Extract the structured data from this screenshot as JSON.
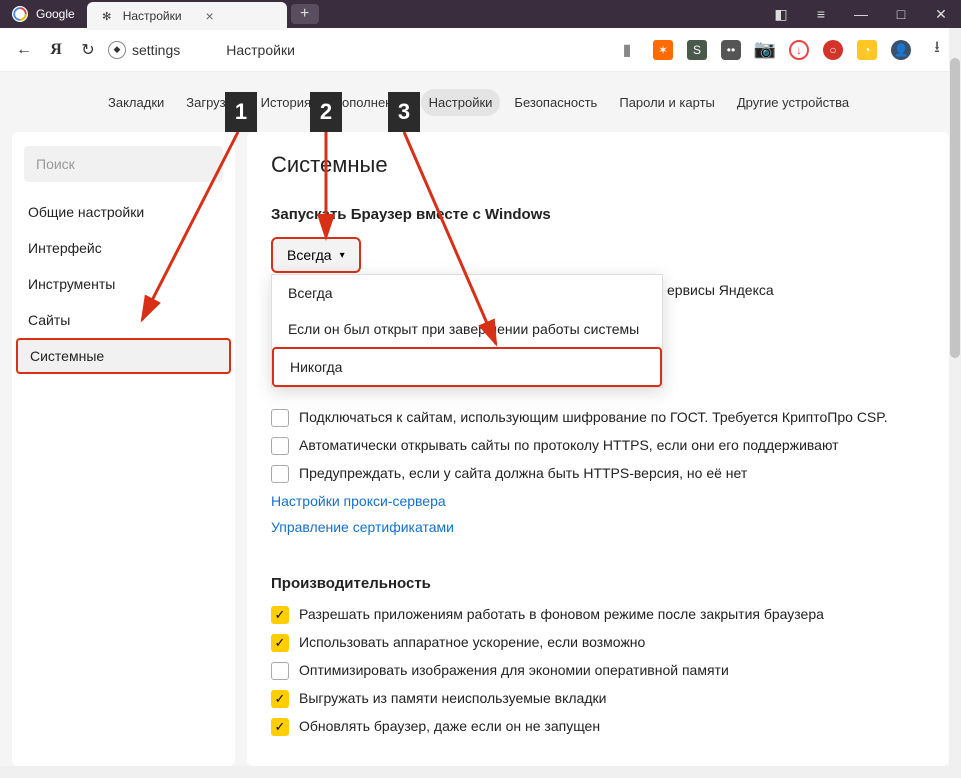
{
  "tabs": [
    {
      "title": "Google"
    },
    {
      "title": "Настройки"
    }
  ],
  "address": {
    "path": "settings",
    "label": "Настройки"
  },
  "subnav": [
    "Закладки",
    "Загрузки",
    "История",
    "Дополнения",
    "Настройки",
    "Безопасность",
    "Пароли и карты",
    "Другие устройства"
  ],
  "sidebar": {
    "search_placeholder": "Поиск",
    "items": [
      "Общие настройки",
      "Интерфейс",
      "Инструменты",
      "Сайты",
      "Системные"
    ]
  },
  "content": {
    "title": "Системные",
    "startup": {
      "label": "Запускать Браузер вместе с Windows",
      "selected": "Всегда",
      "options": [
        "Всегда",
        "Если он был открыт при завершении работы системы",
        "Никогда"
      ],
      "obscured_text": "ервисы Яндекса"
    },
    "network_checks": [
      {
        "checked": false,
        "label": "Подключаться к сайтам, использующим шифрование по ГОСТ. Требуется КриптоПро CSP."
      },
      {
        "checked": false,
        "label": "Автоматически открывать сайты по протоколу HTTPS, если они его поддерживают"
      },
      {
        "checked": false,
        "label": "Предупреждать, если у сайта должна быть HTTPS-версия, но её нет"
      }
    ],
    "links": [
      "Настройки прокси-сервера",
      "Управление сертификатами"
    ],
    "perf_title": "Производительность",
    "perf_checks": [
      {
        "checked": true,
        "label": "Разрешать приложениям работать в фоновом режиме после закрытия браузера"
      },
      {
        "checked": true,
        "label": "Использовать аппаратное ускорение, если возможно"
      },
      {
        "checked": false,
        "label": "Оптимизировать изображения для экономии оперативной памяти"
      },
      {
        "checked": true,
        "label": "Выгружать из памяти неиспользуемые вкладки"
      },
      {
        "checked": true,
        "label": "Обновлять браузер, даже если он не запущен"
      }
    ]
  },
  "annotations": [
    "1",
    "2",
    "3"
  ]
}
